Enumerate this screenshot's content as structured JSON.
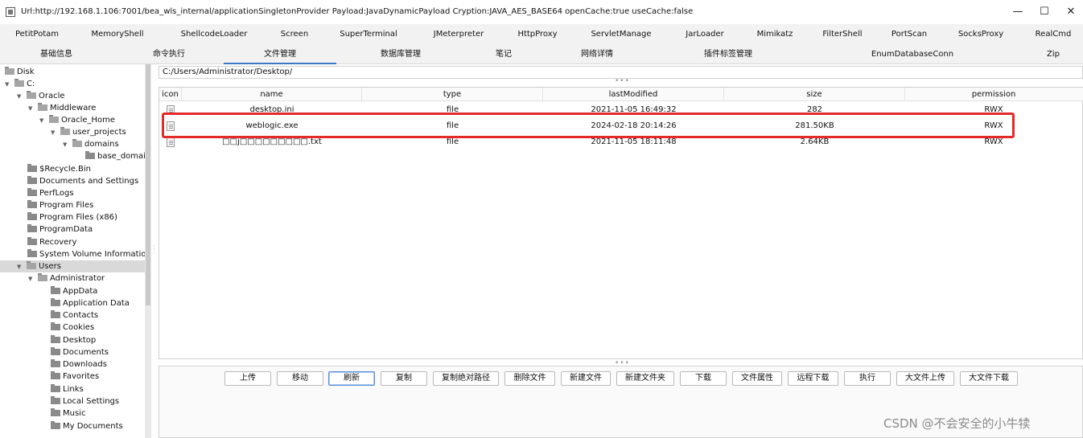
{
  "window": {
    "title": "Url:http://192.168.1.106:7001/bea_wls_internal/applicationSingletonProvider Payload:JavaDynamicPayload Cryption:JAVA_AES_BASE64 openCache:true useCache:false",
    "min": "—",
    "max": "☐",
    "close": "✕"
  },
  "tabs_row1": [
    "PetitPotam",
    "MemoryShell",
    "ShellcodeLoader",
    "Screen",
    "SuperTerminal",
    "JMeterpreter",
    "HttpProxy",
    "ServletManage",
    "JarLoader",
    "Mimikatz",
    "FilterShell",
    "PortScan",
    "SocksProxy",
    "RealCmd"
  ],
  "tabs_row2": [
    "基础信息",
    "命令执行",
    "文件管理",
    "数据库管理",
    "笔记",
    "网络详情",
    "插件标签管理",
    "EnumDatabaseConn",
    "Zip"
  ],
  "active_tab": "文件管理",
  "tree": [
    {
      "label": "Disk",
      "toggle": ""
    },
    {
      "label": "C:",
      "toggle": "▼"
    },
    {
      "label": "Oracle",
      "toggle": "▼"
    },
    {
      "label": "Middleware",
      "toggle": "▼"
    },
    {
      "label": "Oracle_Home",
      "toggle": "▼"
    },
    {
      "label": "user_projects",
      "toggle": "▼"
    },
    {
      "label": "domains",
      "toggle": "▼"
    },
    {
      "label": "base_domain",
      "toggle": ""
    },
    {
      "label": "$Recycle.Bin",
      "toggle": ""
    },
    {
      "label": "Documents and Settings",
      "toggle": ""
    },
    {
      "label": "PerfLogs",
      "toggle": ""
    },
    {
      "label": "Program Files",
      "toggle": ""
    },
    {
      "label": "Program Files (x86)",
      "toggle": ""
    },
    {
      "label": "ProgramData",
      "toggle": ""
    },
    {
      "label": "Recovery",
      "toggle": ""
    },
    {
      "label": "System Volume Information",
      "toggle": ""
    },
    {
      "label": "Users",
      "toggle": "▼"
    },
    {
      "label": "Administrator",
      "toggle": "▼"
    },
    {
      "label": "AppData",
      "toggle": ""
    },
    {
      "label": "Application Data",
      "toggle": ""
    },
    {
      "label": "Contacts",
      "toggle": ""
    },
    {
      "label": "Cookies",
      "toggle": ""
    },
    {
      "label": "Desktop",
      "toggle": ""
    },
    {
      "label": "Documents",
      "toggle": ""
    },
    {
      "label": "Downloads",
      "toggle": ""
    },
    {
      "label": "Favorites",
      "toggle": ""
    },
    {
      "label": "Links",
      "toggle": ""
    },
    {
      "label": "Local Settings",
      "toggle": ""
    },
    {
      "label": "Music",
      "toggle": ""
    },
    {
      "label": "My Documents",
      "toggle": ""
    }
  ],
  "selected_tree_item": "Users",
  "path": "C:/Users/Administrator/Desktop/",
  "table": {
    "columns": [
      "icon",
      "name",
      "type",
      "lastModified",
      "size",
      "permission"
    ],
    "rows": [
      {
        "name": "desktop.ini",
        "type": "file",
        "lastModified": "2021-11-05 16:49:32",
        "size": "282",
        "permission": "RWX"
      },
      {
        "name": "weblogic.exe",
        "type": "file",
        "lastModified": "2024-02-18 20:14:26",
        "size": "281.50KB",
        "permission": "RWX"
      },
      {
        "name": "□□j□□□□□□□□□.txt",
        "type": "file",
        "lastModified": "2021-11-05 18:11:48",
        "size": "2.64KB",
        "permission": "RWX"
      }
    ]
  },
  "toolbar": [
    "上传",
    "移动",
    "刷新",
    "复制",
    "复制绝对路径",
    "删除文件",
    "新建文件",
    "新建文件夹",
    "下载",
    "文件属性",
    "远程下载",
    "执行",
    "大文件上传",
    "大文件下载"
  ],
  "focused_button": "刷新",
  "watermark": "CSDN @不会安全的小牛犊",
  "colors": {
    "highlight": "#e52a2a",
    "active_tab": "#3b78c8"
  }
}
